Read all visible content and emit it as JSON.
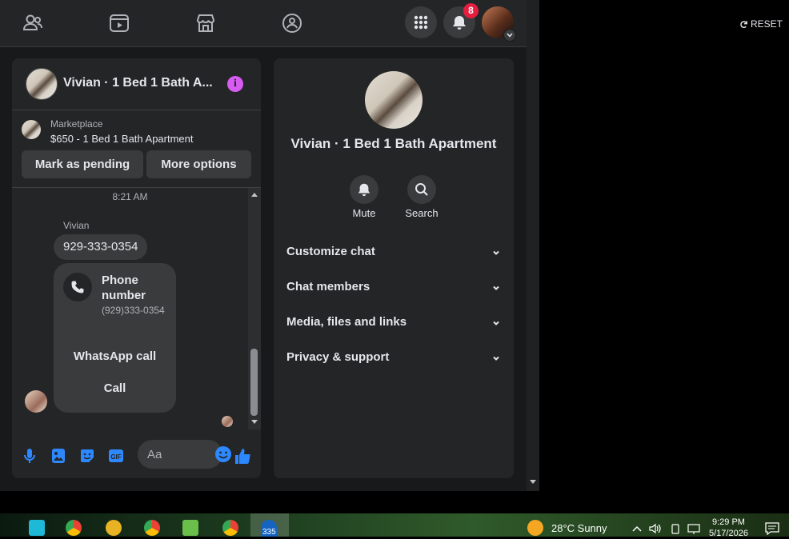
{
  "header": {
    "notification_count": "8"
  },
  "chat": {
    "title": "Vivian · 1 Bed 1 Bath A...",
    "marketplace_label": "Marketplace",
    "listing": "$650 - 1 Bed 1 Bath Apartment",
    "mark_pending": "Mark as pending",
    "more_options": "More options",
    "timestamp": "8:21 AM",
    "sender": "Vivian",
    "message": "929-333-0354",
    "card_title": "Phone number",
    "card_sub": "(929)333-0354",
    "whatsapp_call": "WhatsApp call",
    "call": "Call",
    "composer_placeholder": "Aa"
  },
  "panel": {
    "title": "Vivian · 1 Bed 1 Bath Apartment",
    "mute_label": "Mute",
    "search_label": "Search",
    "sections": [
      "Customize chat",
      "Chat members",
      "Media, files and links",
      "Privacy & support"
    ]
  },
  "toolbar": {
    "reset_label": "RESET"
  },
  "taskbar": {
    "weather": "28°C  Sunny",
    "time": "9:29 PM",
    "date": "5/17/2026",
    "app_badge": "335"
  },
  "colors": {
    "accent_blue": "#2d88ff",
    "info_purple": "#d65cf2",
    "badge_red": "#e41e3f"
  }
}
